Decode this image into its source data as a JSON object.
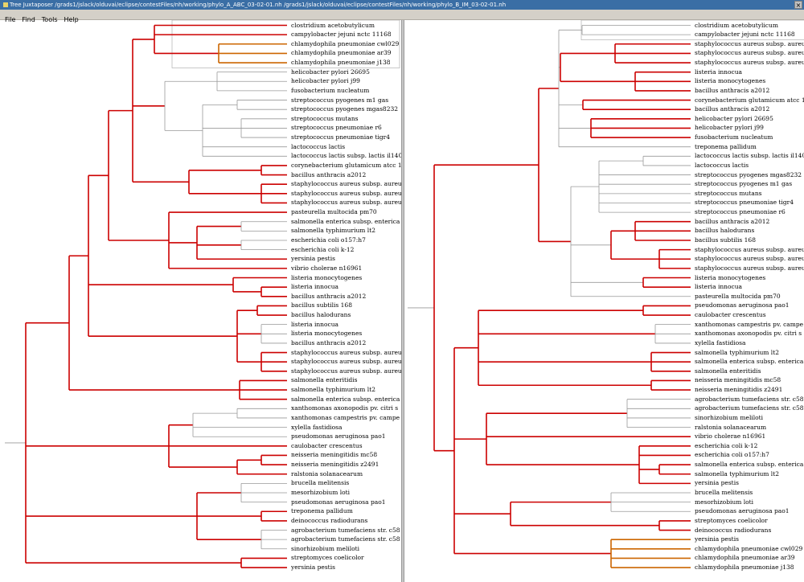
{
  "window": {
    "title": "Tree Juxtaposer /grads1/jslack/olduvai/eclipse/contestFiles/nh/working/phylo_A_ABC_03-02-01.nh /grads1/jslack/olduvai/eclipse/contestFiles/nh/working/phylo_B_IM_03-02-01.nh",
    "close_glyph": "×"
  },
  "menu": [
    "File",
    "Find",
    "Tools",
    "Help"
  ],
  "colors": {
    "highlight": "#cc0000",
    "normal": "#999999",
    "selection": "#cc6600"
  },
  "left_tree": {
    "leaves": [
      "clostridium acetobutylicum",
      "campylobacter jejuni nctc 11168",
      "chlamydophila pneumoniae cwl029",
      "chlamydophila pneumoniae ar39",
      "chlamydophila pneumoniae j138",
      "helicobacter pylori 26695",
      "helicobacter pylori j99",
      "fusobacterium nucleatum",
      "streptococcus pyogenes m1 gas",
      "streptococcus pyogenes mgas8232",
      "streptococcus mutans",
      "streptococcus pneumoniae r6",
      "streptococcus pneumoniae tigr4",
      "lactococcus lactis",
      "lactococcus lactis subsp. lactis il140",
      "corynebacterium glutamicum atcc 1",
      "bacillus anthracis a2012",
      "staphylococcus aureus subsp. aureu",
      "staphylococcus aureus subsp. aureu",
      "staphylococcus aureus subsp. aureu",
      "pasteurella multocida pm70",
      "salmonella enterica subsp. enterica",
      "salmonella typhimurium lt2",
      "escherichia coli o157:h7",
      "escherichia coli k-12",
      "yersinia pestis",
      "vibrio cholerae n16961",
      "listeria monocytogenes",
      "listeria innocua",
      "bacillus anthracis a2012",
      "bacillus subtilis 168",
      "bacillus halodurans",
      "listeria innocua",
      "listeria monocytogenes",
      "bacillus anthracis a2012",
      "staphylococcus aureus subsp. aureu",
      "staphylococcus aureus subsp. aureu",
      "staphylococcus aureus subsp. aureu",
      "salmonella enteritidis",
      "salmonella typhimurium lt2",
      "salmonella enterica subsp. enterica",
      "xanthomonas axonopodis pv. citri s",
      "xanthomonas campestris pv. campe",
      "xylella fastidiosa",
      "pseudomonas aeruginosa pao1",
      "caulobacter crescentus",
      "neisseria meningitidis mc58",
      "neisseria meningitidis z2491",
      "ralstonia solanacearum",
      "brucella melitensis",
      "mesorhizobium loti",
      "pseudomonas aeruginosa pao1",
      "treponema pallidum",
      "deinococcus radiodurans",
      "agrobacterium tumefaciens str. c58",
      "agrobacterium tumefaciens str. c58",
      "sinorhizobium meliloti",
      "streptomyces coelicolor",
      "yersinia pestis"
    ]
  },
  "right_tree": {
    "leaves": [
      "clostridium acetobutylicum",
      "campylobacter jejuni nctc 11168",
      "staphylococcus aureus subsp. aureu",
      "staphylococcus aureus subsp. aureu",
      "staphylococcus aureus subsp. aureu",
      "listeria innocua",
      "listeria monocytogenes",
      "bacillus anthracis a2012",
      "corynebacterium glutamicum atcc 1",
      "bacillus anthracis a2012",
      "helicobacter pylori 26695",
      "helicobacter pylori j99",
      "fusobacterium nucleatum",
      "treponema pallidum",
      "lactococcus lactis subsp. lactis il140",
      "lactococcus lactis",
      "streptococcus pyogenes mgas8232",
      "streptococcus pyogenes m1 gas",
      "streptococcus mutans",
      "streptococcus pneumoniae tigr4",
      "streptococcus pneumoniae r6",
      "bacillus anthracis a2012",
      "bacillus halodurans",
      "bacillus subtilis 168",
      "staphylococcus aureus subsp. aureu",
      "staphylococcus aureus subsp. aureu",
      "staphylococcus aureus subsp. aureu",
      "listeria monocytogenes",
      "listeria innocua",
      "pasteurella multocida pm70",
      "pseudomonas aeruginosa pao1",
      "caulobacter crescentus",
      "xanthomonas campestris pv. campe",
      "xanthomonas axonopodis pv. citri s",
      "xylella fastidiosa",
      "salmonella typhimurium lt2",
      "salmonella enterica subsp. enterica",
      "salmonella enteritidis",
      "neisseria meningitidis mc58",
      "neisseria meningitidis z2491",
      "agrobacterium tumefaciens str. c58",
      "agrobacterium tumefaciens str. c58",
      "sinorhizobium meliloti",
      "ralstonia solanacearum",
      "vibrio cholerae n16961",
      "escherichia coli k-12",
      "escherichia coli o157:h7",
      "salmonella enterica subsp. enterica",
      "salmonella typhimurium lt2",
      "yersinia pestis",
      "brucella melitensis",
      "mesorhizobium loti",
      "pseudomonas aeruginosa pao1",
      "streptomyces coelicolor",
      "deinococcus radiodurans",
      "yersinia pestis",
      "chlamydophila pneumoniae cwl029",
      "chlamydophila pneumoniae ar39",
      "chlamydophila pneumoniae j138"
    ]
  }
}
